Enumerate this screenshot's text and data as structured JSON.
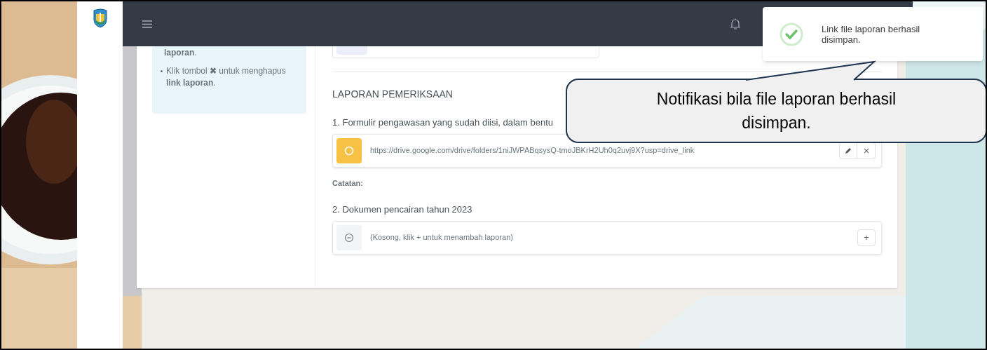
{
  "info_panel": {
    "items": [
      {
        "text": "**laporan**.",
        "bullet": false
      },
      {
        "text": "Klik tombol **✖** untuk menghapus **link laporan**.",
        "bullet": true
      }
    ]
  },
  "section": {
    "title": "LAPORAN PEMERIKSAAN",
    "items": [
      {
        "kind": "filled",
        "label": "1. Formulir pengawasan yang sudah diisi, dalam bentu",
        "link": "https://drive.google.com/drive/folders/1niJWPABqsysQ-tmoJBKrH2Uh0q2uvj9X?usp=drive_link",
        "note_label": "Catatan:"
      },
      {
        "kind": "empty",
        "label": "2. Dokumen pencairan tahun 2023",
        "empty_text": "(Kosong, klik + untuk menambah laporan)",
        "add_button": "+"
      }
    ]
  },
  "toast": {
    "message": "Link file laporan berhasil disimpan."
  },
  "annotation": {
    "text": "Notifikasi bila file laporan berhasil disimpan."
  }
}
